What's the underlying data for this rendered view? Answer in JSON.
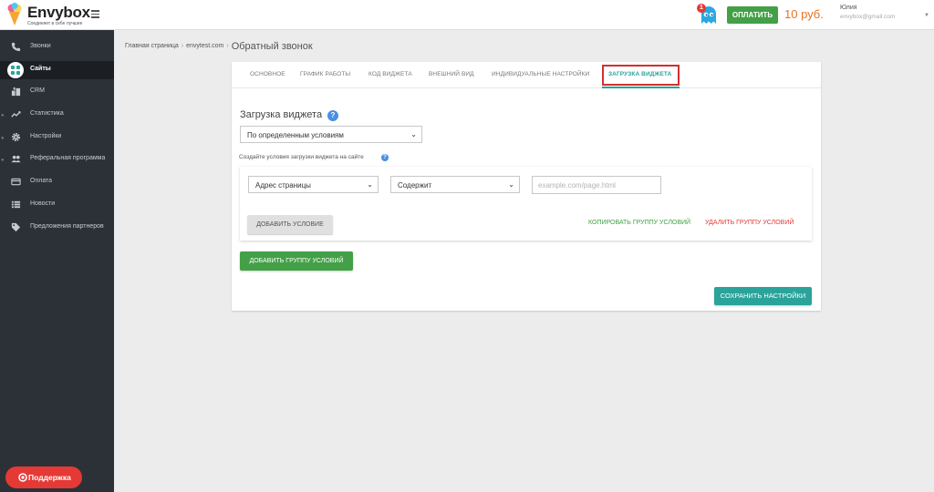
{
  "app": {
    "logo_name": "Envybox",
    "logo_tagline": "Соединяет в себе лучшее",
    "notification_count": "1",
    "pay_label": "ОПЛАТИТЬ",
    "balance": "10 руб.",
    "user_name": "Юлия",
    "user_email": "envybox@gmail.com"
  },
  "sidebar": {
    "items": [
      {
        "label": "Звонки",
        "icon": "phone-icon"
      },
      {
        "label": "Сайты",
        "icon": "grid-icon"
      },
      {
        "label": "CRM",
        "icon": "crm-icon"
      },
      {
        "label": "Статистика",
        "icon": "trend-icon"
      },
      {
        "label": "Настройки",
        "icon": "gear-icon"
      },
      {
        "label": "Реферальная программа",
        "icon": "users-icon"
      },
      {
        "label": "Оплата",
        "icon": "card-icon"
      },
      {
        "label": "Новости",
        "icon": "list-icon"
      },
      {
        "label": "Предложения партнеров",
        "icon": "tag-icon"
      }
    ],
    "support_label": "Поддержка"
  },
  "breadcrumb": {
    "home": "Главная страница",
    "site": "envytest.com",
    "current": "Обратный звонок"
  },
  "tabs": [
    "ОСНОВНОЕ",
    "ГРАФИК РАБОТЫ",
    "КОД ВИДЖЕТА",
    "ВНЕШНИЙ ВИД",
    "ИНДИВИДУАЛЬНЫЕ НАСТРОЙКИ",
    "ЗАГРУЗКА ВИДЖЕТА"
  ],
  "active_tab": "ЗАГРУЗКА ВИДЖЕТА",
  "form": {
    "title": "Загрузка виджета",
    "mode_select": "По определенным условиям",
    "hint": "Создайте условия загрузки виджета на сайте",
    "condition_field": "Адрес страницы",
    "condition_operator": "Содержит",
    "condition_value_placeholder": "example.com/page.html",
    "add_condition": "ДОБАВИТЬ УСЛОВИЕ",
    "copy_group": "КОПИРОВАТЬ ГРУППУ УСЛОВИЙ",
    "delete_group": "УДАЛИТЬ ГРУППУ УСЛОВИЙ",
    "add_group": "ДОБАВИТЬ ГРУППУ УСЛОВИЙ",
    "save": "СОХРАНИТЬ НАСТРОЙКИ"
  },
  "colors": {
    "teal": "#2aa39b",
    "green": "#43a047",
    "red": "#e53935",
    "sidebar": "#2b3137",
    "balance": "#e57325"
  }
}
